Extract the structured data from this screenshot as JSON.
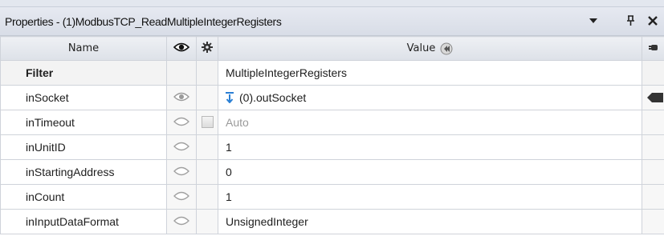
{
  "panel": {
    "title": "Properties - (1)ModbusTCP_ReadMultipleIntegerRegisters"
  },
  "columns": {
    "name": "Name",
    "value": "Value"
  },
  "filter_row": {
    "label": "Filter",
    "value": "MultipleIntegerRegisters"
  },
  "rows": [
    {
      "name": "inSocket",
      "value": "(0).outSocket",
      "visibility": "visible"
    },
    {
      "name": "inTimeout",
      "value": "Auto",
      "visibility": "hidden"
    },
    {
      "name": "inUnitID",
      "value": "1",
      "visibility": "hidden"
    },
    {
      "name": "inStartingAddress",
      "value": "0",
      "visibility": "hidden"
    },
    {
      "name": "inCount",
      "value": "1",
      "visibility": "hidden"
    },
    {
      "name": "inInputDataFormat",
      "value": "UnsignedInteger",
      "visibility": "hidden"
    }
  ],
  "colors": {
    "link_arrow": "#2a7fd4",
    "muted_text": "#9a9a9a"
  },
  "icons": {
    "menu": "triangle-down-icon",
    "pin": "pin-icon",
    "close": "close-icon",
    "eye": "eye-icon",
    "gear": "gear-icon",
    "value_header": "reset-value-icon",
    "link_arrow": "link-arrow-icon",
    "plug": "plug-icon"
  }
}
